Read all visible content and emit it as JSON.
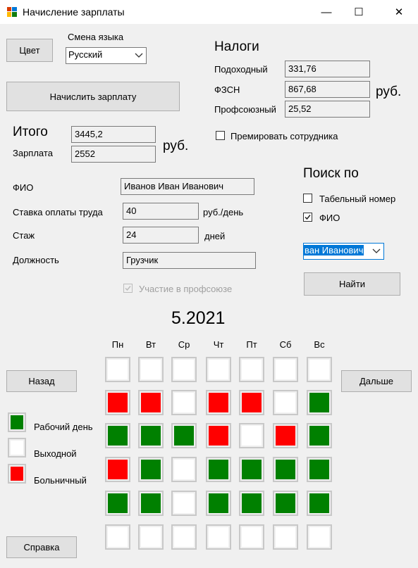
{
  "window": {
    "title": "Начисление зарплаты",
    "minimize": "—",
    "maximize": "☐",
    "close": "✕"
  },
  "buttons": {
    "color": "Цвет",
    "calc": "Начислить зарплату",
    "back": "Назад",
    "next": "Дальше",
    "help": "Справка",
    "find": "Найти"
  },
  "language": {
    "label": "Смена языка",
    "selected": "Русский"
  },
  "taxes": {
    "heading": "Налоги",
    "income_label": "Подоходный",
    "income_value": "331,76",
    "fszn_label": "ФЗСН",
    "fszn_value": "867,68",
    "union_label": "Профсоюзный",
    "union_value": "25,52",
    "currency": "руб."
  },
  "bonus": {
    "label": "Премировать сотрудника",
    "checked": false
  },
  "totals": {
    "itogo_label": "Итого",
    "itogo_value": "3445,2",
    "salary_label": "Зарплата",
    "salary_value": "2552",
    "currency": "руб."
  },
  "employee": {
    "fio_label": "ФИО",
    "fio_value": "Иванов Иван Иванович",
    "rate_label": "Ставка оплаты труда",
    "rate_value": "40",
    "rate_unit": "руб./день",
    "exp_label": "Стаж",
    "exp_value": "24",
    "exp_unit": "дней",
    "position_label": "Должность",
    "position_value": "Грузчик",
    "union_label": "Участие в профсоюзе",
    "union_checked": true
  },
  "search": {
    "heading": "Поиск по",
    "tab_label": "Табельный номер",
    "tab_checked": false,
    "fio_label": "ФИО",
    "fio_checked": true,
    "combo_value": "ван Иванович"
  },
  "calendar": {
    "month": "5.2021",
    "days": [
      "Пн",
      "Вт",
      "Ср",
      "Чт",
      "Пт",
      "Сб",
      "Вс"
    ],
    "grid": [
      [
        "W",
        "W",
        "W",
        "W",
        "W",
        "W",
        "W"
      ],
      [
        "S",
        "S",
        "W",
        "S",
        "S",
        "W",
        "G"
      ],
      [
        "G",
        "G",
        "G",
        "S",
        "W",
        "S",
        "G"
      ],
      [
        "S",
        "G",
        "W",
        "G",
        "G",
        "G",
        "G"
      ],
      [
        "G",
        "G",
        "W",
        "G",
        "G",
        "G",
        "G"
      ],
      [
        "W",
        "W",
        "W",
        "W",
        "W",
        "W",
        "W"
      ]
    ]
  },
  "legend": {
    "work": "Рабочий день",
    "off": "Выходной",
    "sick": "Больничный"
  },
  "colors": {
    "work": "#008000",
    "off": "#ffffff",
    "sick": "#ff0000",
    "selection": "#0078d7"
  }
}
